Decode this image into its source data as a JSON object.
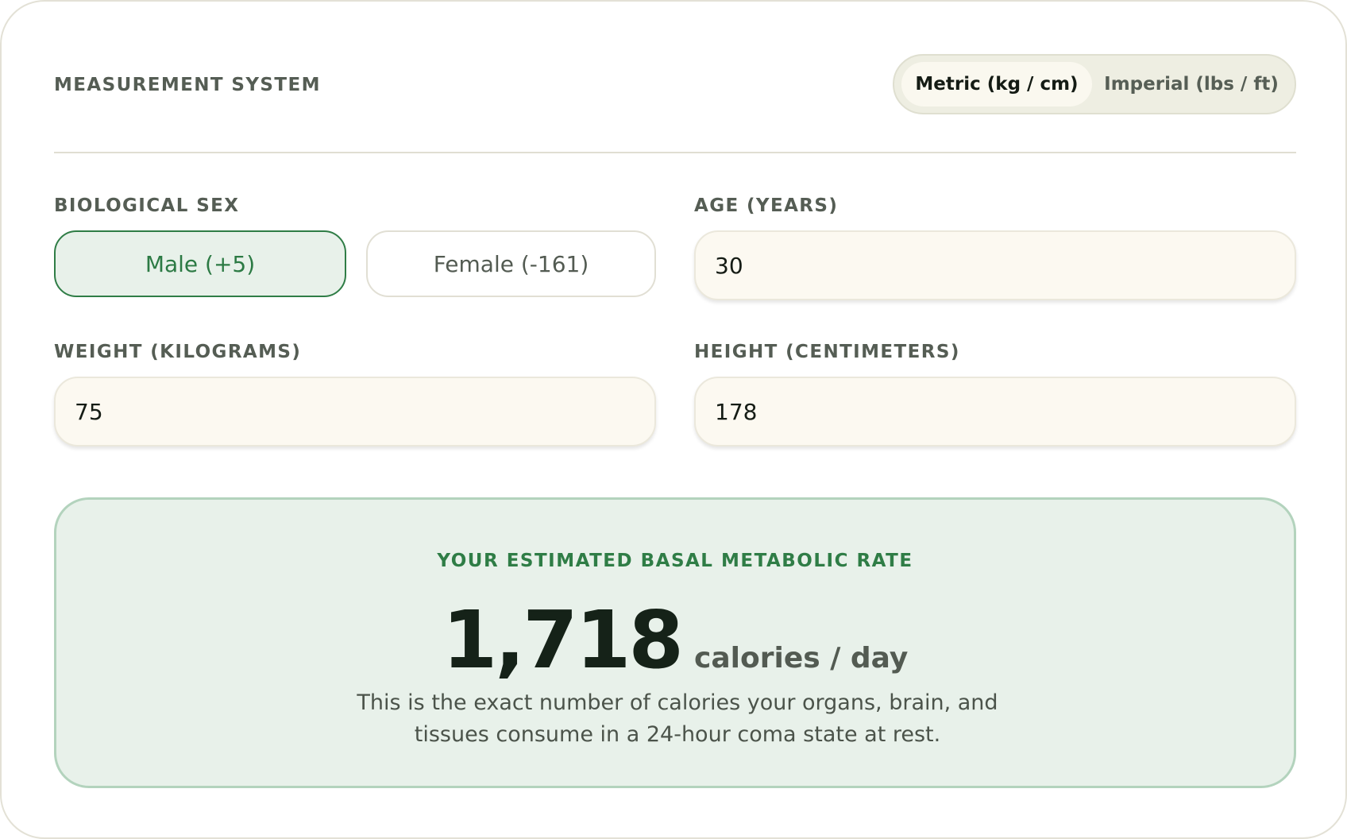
{
  "measurement": {
    "label": "MEASUREMENT SYSTEM",
    "options": [
      "Metric (kg / cm)",
      "Imperial (lbs / ft)"
    ],
    "selected": "Metric (kg / cm)"
  },
  "sex": {
    "label": "BIOLOGICAL SEX",
    "options": [
      "Male (+5)",
      "Female (-161)"
    ],
    "selected": "Male (+5)"
  },
  "age": {
    "label": "AGE (YEARS)",
    "value": "30"
  },
  "weight": {
    "label": "WEIGHT (KILOGRAMS)",
    "value": "75"
  },
  "height": {
    "label": "HEIGHT (CENTIMETERS)",
    "value": "178"
  },
  "result": {
    "title": "YOUR ESTIMATED BASAL METABOLIC RATE",
    "value": "1,718",
    "unit": "calories / day",
    "description": "This is the exact number of calories your organs, brain, and tissues consume in a 24-hour coma state at rest."
  },
  "colors": {
    "accent_green": "#2f7d46",
    "selected_bg": "#e8f1ea",
    "result_border": "#b3d3bd",
    "input_bg": "#fcf9f1"
  }
}
